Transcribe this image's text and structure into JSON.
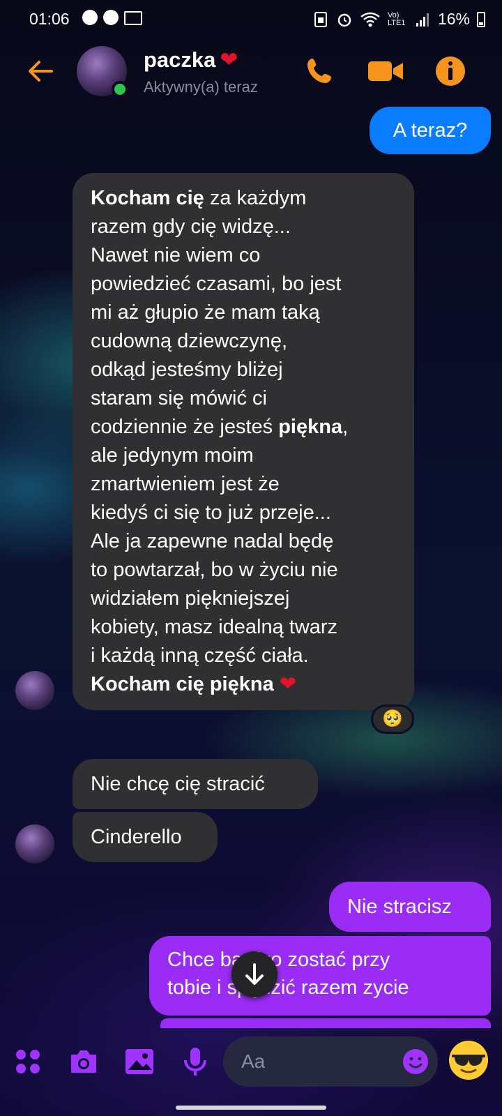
{
  "status_bar": {
    "time": "01:06",
    "notification_icons": [
      "messenger-icon",
      "messenger-icon",
      "gmail-icon"
    ],
    "signal_label": "Vo) LTE1",
    "battery": "16%"
  },
  "header": {
    "contact_name": "paczka",
    "contact_emoji": "❤",
    "contact_status": "Aktywny(a) teraz",
    "accent_color": "#f7941d"
  },
  "messages": {
    "m1": "A teraz?",
    "m2": {
      "lines": [
        {
          "bold": "Kocham cię",
          "rest": " za każdym"
        },
        {
          "text": "razem gdy cię widzę..."
        },
        {
          "text": "Nawet nie wiem co"
        },
        {
          "text": "powiedzieć czasami, bo jest"
        },
        {
          "text": "mi aż głupio że mam taką"
        },
        {
          "text": "cudowną dziewczynę,"
        },
        {
          "text": "odkąd jesteśmy bliżej"
        },
        {
          "text": "staram się mówić ci"
        },
        {
          "pre": "codziennie że jesteś ",
          "bold": "piękna",
          "post": ","
        },
        {
          "text": "ale jedynym moim"
        },
        {
          "text": "zmartwieniem jest że"
        },
        {
          "text": "kiedyś ci się to już przeje..."
        },
        {
          "text": "Ale ja zapewne nadal będę"
        },
        {
          "text": "to powtarzał, bo w życiu nie"
        },
        {
          "text": "widziałem piękniejszej"
        },
        {
          "text": "kobiety, masz idealną twarz"
        },
        {
          "text": "i każdą inną część ciała."
        },
        {
          "bold": "Kocham cię piękna",
          "emoji": "❤"
        }
      ],
      "reaction": "🥺"
    },
    "m3": "Nie chcę cię stracić",
    "m4": "Cinderello",
    "m5": "Nie stracisz",
    "m6_line1": "Chce bardzo zostać przy",
    "m6_line2": "tobie i spędzić razem zycie"
  },
  "composer": {
    "placeholder": "Aa",
    "quick_reaction": "😎"
  },
  "colors": {
    "outgoing_blue": "#0a7cff",
    "outgoing_purple": "#9b2cf5",
    "incoming": "#303033",
    "icon_purple": "#a033ff"
  }
}
